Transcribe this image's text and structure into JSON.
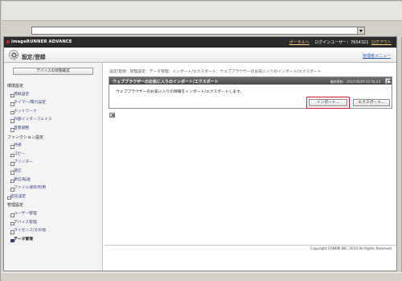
{
  "brand": {
    "name": "imageRUNNER ADVANCE"
  },
  "topnav": {
    "portal": "ポータルへ",
    "login_user": "ログインユーザー：7654321",
    "logout": "ログアウト"
  },
  "header": {
    "title": "設定/登録",
    "admin_menu": "管理者メニュー"
  },
  "sidebar": {
    "status_button": "デバイスの状態確認",
    "sections": [
      {
        "group": "環境設定",
        "items": [
          "用紙設定",
          "タイマー/電力設定",
          "ネットワーク",
          "外部インターフェイス",
          "音量調整"
        ]
      },
      {
        "group": "ファンクション設定",
        "items": [
          "共通",
          "コピー",
          "プリンター",
          "送信",
          "受信/転送",
          "ファイル保存/利用"
        ]
      }
    ],
    "dest_settings": "宛先設定",
    "mgmt_group": "管理設定",
    "mgmt_items": [
      "ユーザー管理",
      "デバイス管理",
      "ライセンス/その他",
      "データ管理"
    ]
  },
  "main": {
    "breadcrumb": "設定/登録：管理設定：データ管理：インポート/エクスポート：ウェブブラウザーのお気に入りのインポート/エクスポート",
    "panel_title": "ウェブブラウザーのお気に入りのインポート/エクスポート",
    "last_update": "最終更新：2013 05/29 11:54:23",
    "description": "ウェブブラウザーのお気に入りの情報をインポート/エクスポートします。",
    "import_label": "インポート...",
    "export_label": "エクスポート..."
  },
  "footer": {
    "copyright": "Copyright CANON INC. 2010 All Rights Reserved"
  },
  "colors": {
    "highlight": "#d01c2a",
    "brand_bar": "#2b2b2b",
    "panel_header": "#555555",
    "link": "#2860b0"
  }
}
